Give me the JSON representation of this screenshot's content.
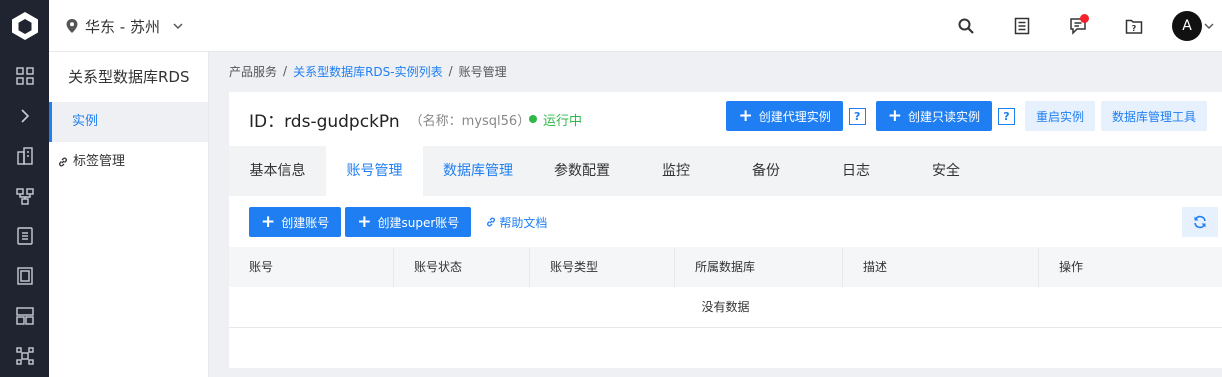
{
  "topbar": {
    "region": "华东 - 苏州",
    "avatar_initial": "A",
    "icons": [
      "search-icon",
      "document-list-icon",
      "message-icon",
      "help-folder-icon"
    ]
  },
  "rail": {
    "icons": [
      "grid-icon",
      "chevron-right-icon",
      "building-icon",
      "network-icon",
      "list-icon",
      "server-icon",
      "layout-icon",
      "topology-icon"
    ]
  },
  "sidebar": {
    "title": "关系型数据库RDS",
    "items": [
      {
        "label": "实例",
        "active": true
      },
      {
        "label": "标签管理",
        "active": false
      }
    ]
  },
  "breadcrumb": {
    "items": [
      "产品服务",
      "关系型数据库RDS-实例列表",
      "账号管理"
    ]
  },
  "instance": {
    "id": "ID：rds-gudpckPn",
    "name": "（名称：mysql56）",
    "status": "运行中",
    "status_color": "#2fb84a"
  },
  "actions": {
    "create_proxy": "创建代理实例",
    "create_readonly": "创建只读实例",
    "help_mark": "?",
    "restart": "重启实例",
    "db_tool": "数据库管理工具"
  },
  "tabs": [
    {
      "label": "基本信息"
    },
    {
      "label": "账号管理"
    },
    {
      "label": "数据库管理"
    },
    {
      "label": "参数配置"
    },
    {
      "label": "监控"
    },
    {
      "label": "备份"
    },
    {
      "label": "日志"
    },
    {
      "label": "安全"
    }
  ],
  "toolbar": {
    "create_account": "创建账号",
    "create_super": "创建super账号",
    "help_doc": "帮助文档"
  },
  "table": {
    "columns": [
      "账号",
      "账号状态",
      "账号类型",
      "所属数据库",
      "描述",
      "操作"
    ],
    "empty_text": "没有数据"
  },
  "colors": {
    "accent": "#1f7ff2",
    "rail_bg": "#1f2430"
  }
}
